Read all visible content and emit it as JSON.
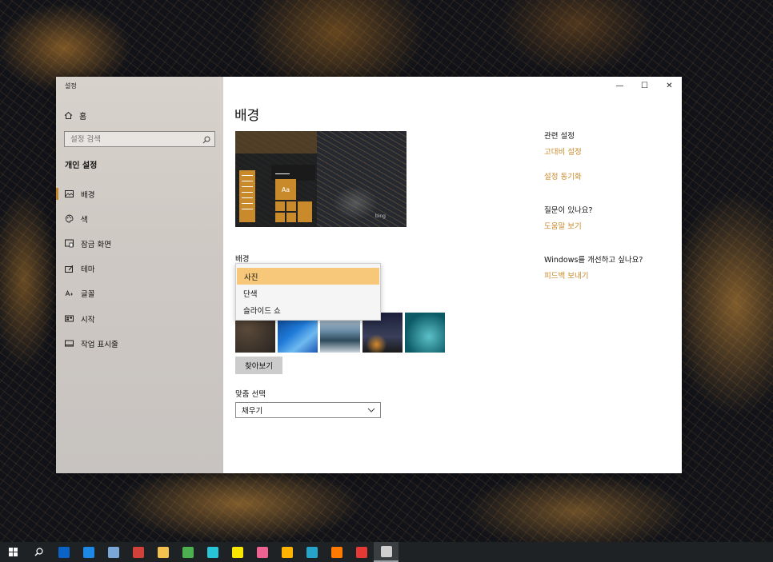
{
  "window": {
    "title": "설정",
    "controls": {
      "minimize": "—",
      "maximize": "☐",
      "close": "✕"
    }
  },
  "sidebar": {
    "home_label": "홈",
    "search_placeholder": "설정 검색",
    "section_title": "개인 설정",
    "items": [
      {
        "label": "배경",
        "icon": "picture-icon",
        "active": true
      },
      {
        "label": "색",
        "icon": "palette-icon",
        "active": false
      },
      {
        "label": "잠금 화면",
        "icon": "lock-screen-icon",
        "active": false
      },
      {
        "label": "테마",
        "icon": "theme-icon",
        "active": false
      },
      {
        "label": "글꼴",
        "icon": "font-icon",
        "active": false
      },
      {
        "label": "시작",
        "icon": "start-icon",
        "active": false
      },
      {
        "label": "작업 표시줄",
        "icon": "taskbar-icon",
        "active": false
      }
    ]
  },
  "main": {
    "title": "배경",
    "background_label": "배경",
    "dropdown_options": [
      "사진",
      "단색",
      "슬라이드 쇼"
    ],
    "dropdown_selected": "사진",
    "browse_label": "찾아보기",
    "fit_label": "맞춤 선택",
    "fit_value": "채우기",
    "preview": {
      "tile_text": "Aa",
      "brand_text": "bing"
    }
  },
  "related": {
    "heading": "관련 설정",
    "links": [
      "고대비 설정",
      "설정 동기화"
    ],
    "help_heading": "질문이 있나요?",
    "help_link": "도움말 보기",
    "improve_heading": "Windows를 개선하고 싶나요?",
    "feedback_link": "피드백 보내기"
  },
  "taskbar": {
    "apps": [
      {
        "name": "outlook-icon",
        "color": "#0a64c8"
      },
      {
        "name": "edge-icon",
        "color": "#1e88e5"
      },
      {
        "name": "notepad-icon",
        "color": "#7aa6d8"
      },
      {
        "name": "app-red-icon",
        "color": "#d0413a"
      },
      {
        "name": "file-explorer-icon",
        "color": "#f2c14e"
      },
      {
        "name": "chrome-icon",
        "color": "#4caf50"
      },
      {
        "name": "bird-app-icon",
        "color": "#28c4d8"
      },
      {
        "name": "kakaotalk-icon",
        "color": "#f7e600"
      },
      {
        "name": "pink-app-icon",
        "color": "#f06292"
      },
      {
        "name": "video-app-icon",
        "color": "#ffb300"
      },
      {
        "name": "phone-app-icon",
        "color": "#26a3c9"
      },
      {
        "name": "search-app-icon",
        "color": "#ff7a00"
      },
      {
        "name": "acrobat-icon",
        "color": "#e53935"
      },
      {
        "name": "settings-icon",
        "color": "#cfcfcf"
      }
    ],
    "accent": "#c98a2b"
  }
}
